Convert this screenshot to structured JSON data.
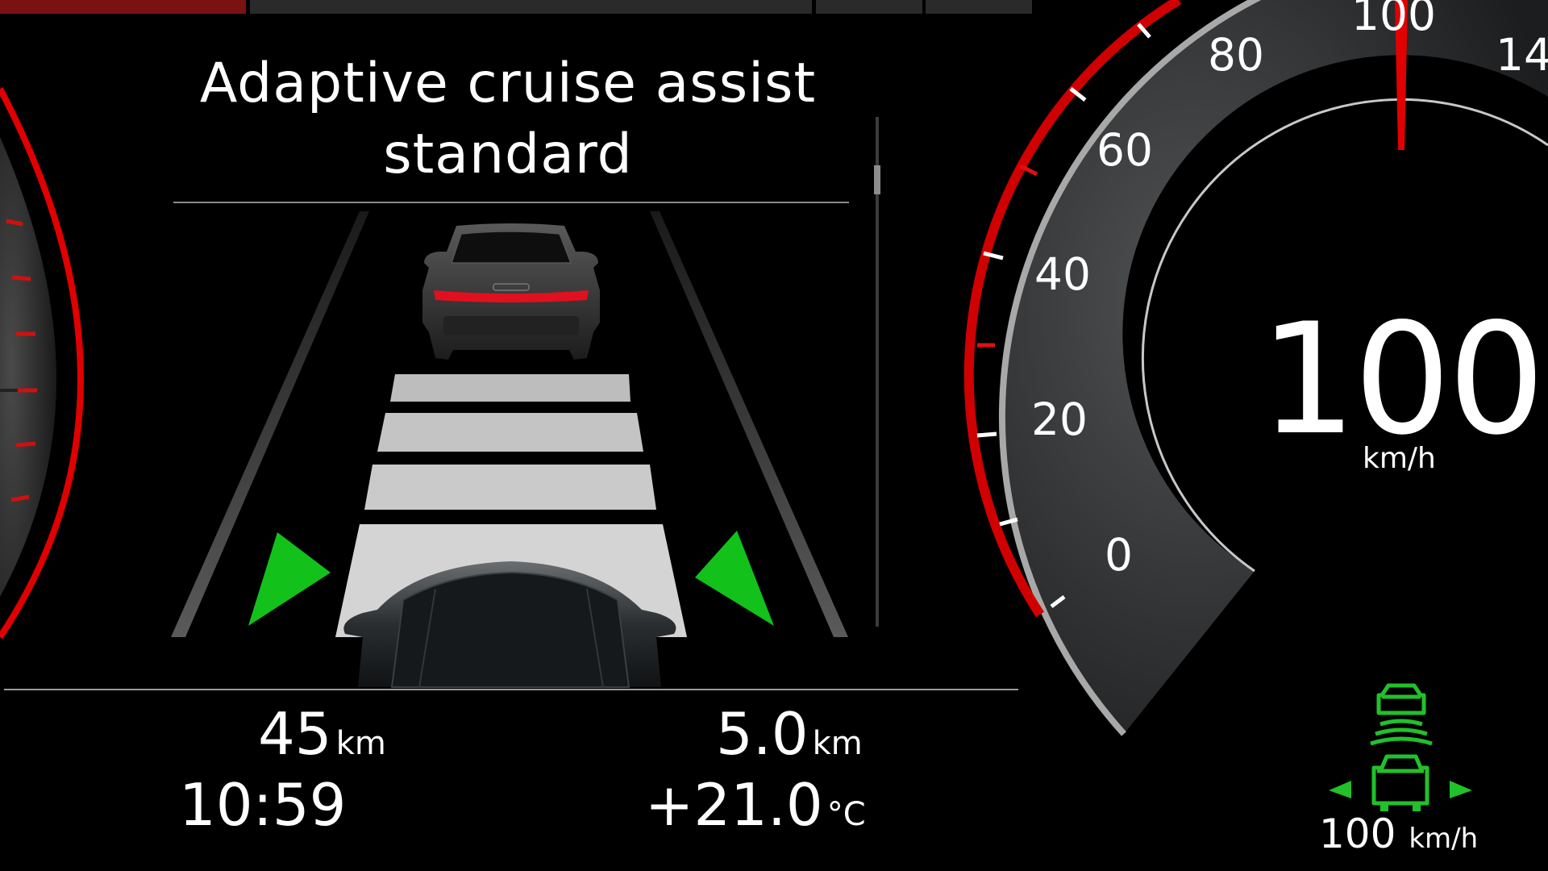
{
  "acc_panel": {
    "title_line1": "Adaptive cruise assist",
    "title_line2": "standard"
  },
  "trip": {
    "range_value": "45",
    "range_unit": "km",
    "clock": "10:59",
    "distance_value": "5.0",
    "distance_unit": "km",
    "temperature_value": "+21.0",
    "temperature_unit": "°C"
  },
  "speedometer": {
    "tick_labels": {
      "t0": "0",
      "t20": "20",
      "t40": "40",
      "t60": "60",
      "t80": "80",
      "t100": "100",
      "t140": "14"
    },
    "speed_value": "100",
    "speed_unit": "km/h",
    "needle_speed": 100
  },
  "acc_indicator": {
    "icon": "acc-vehicle-distance-icon",
    "set_speed_value": "100",
    "set_speed_unit": "km/h",
    "color": "#22c02a"
  },
  "colors": {
    "accent_red": "#e00000",
    "active_green": "#12c21a",
    "background": "#000000"
  }
}
